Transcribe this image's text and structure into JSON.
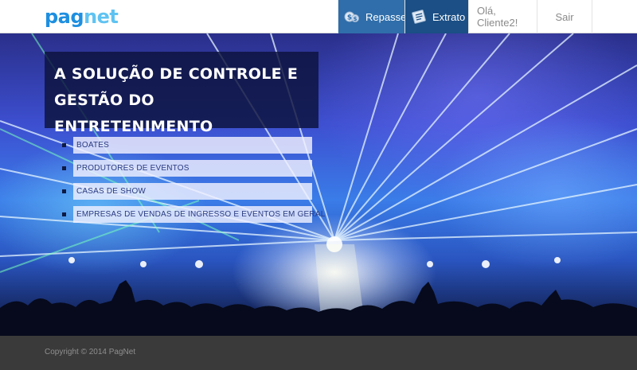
{
  "header": {
    "logo": {
      "part1": "pag",
      "part2": "net"
    },
    "nav": {
      "repasse_label": "Repasse",
      "extrato_label": "Extrato",
      "greeting": "Olá, Cliente2!",
      "sair_label": "Sair"
    },
    "colors": {
      "repasse_bg": "#2f6eaa",
      "extrato_bg": "#1b4f85",
      "logo_blue": "#1e8fe0",
      "logo_light": "#5fc3f2"
    },
    "icons": {
      "repasse": "money-transfer-icon",
      "extrato": "statement-icon"
    }
  },
  "hero": {
    "headline_line1": "A SOLUÇÃO DE CONTROLE E",
    "headline_line2": "GESTÃO DO ENTRETENIMENTO",
    "items": [
      {
        "label": "BOATES"
      },
      {
        "label": "PRODUTORES DE EVENTOS"
      },
      {
        "label": "CASAS DE SHOW"
      },
      {
        "label": "EMPRESAS DE VENDAS DE INGRESSO E EVENTOS EM GERAL"
      }
    ]
  },
  "footer": {
    "copyright": "Copyright © 2014 PagNet"
  }
}
